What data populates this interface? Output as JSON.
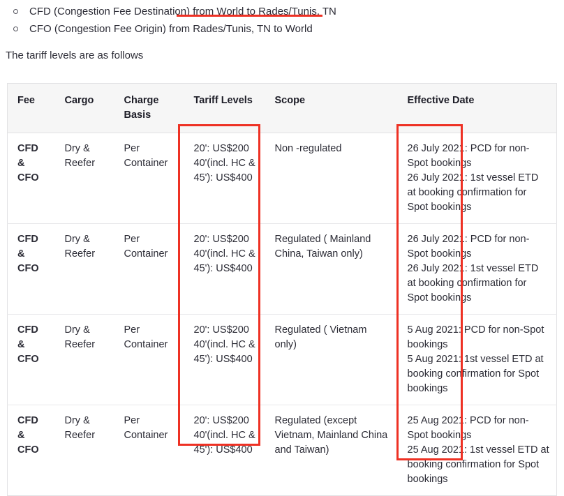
{
  "intro": {
    "bullets": [
      {
        "plain": "CFD (Congestion Fee Destination) ",
        "underlined": "from World to Rades/Tunis, TN"
      },
      {
        "plain": "CFO (Congestion Fee Origin) from Rades/Tunis, TN to World",
        "underlined": ""
      }
    ],
    "lead_paragraph": "The tariff levels are as follows"
  },
  "table": {
    "headers": [
      "Fee",
      "Cargo",
      "Charge Basis",
      "Tariff Levels",
      "Scope",
      "Effective Date"
    ],
    "rows": [
      {
        "fee": [
          "CFD",
          "&",
          "CFO"
        ],
        "cargo": [
          "Dry &",
          "Reefer"
        ],
        "charge_basis": [
          "Per Container"
        ],
        "tariff_levels": [
          "20': US$200",
          "40'(incl. HC & 45'): US$400"
        ],
        "scope": [
          "Non -regulated"
        ],
        "effective_date": [
          "26 July 2021: PCD for non-Spot bookings",
          "26 July 2021: 1st vessel ETD at booking confirmation for Spot bookings"
        ]
      },
      {
        "fee": [
          "CFD",
          "&",
          "CFO"
        ],
        "cargo": [
          "Dry &",
          "Reefer"
        ],
        "charge_basis": [
          "Per Container"
        ],
        "tariff_levels": [
          "20': US$200",
          "40'(incl. HC & 45'): US$400"
        ],
        "scope": [
          "Regulated ( Mainland China, Taiwan only)"
        ],
        "effective_date": [
          "26 July 2021: PCD for non-Spot bookings",
          "26 July 2021: 1st vessel ETD at booking confirmation for Spot bookings"
        ]
      },
      {
        "fee": [
          "CFD",
          "&",
          "CFO"
        ],
        "cargo": [
          "Dry &",
          "Reefer"
        ],
        "charge_basis": [
          "Per Container"
        ],
        "tariff_levels": [
          "20': US$200",
          "40'(incl. HC & 45'): US$400"
        ],
        "scope": [
          "Regulated ( Vietnam only)"
        ],
        "effective_date": [
          "5 Aug 2021: PCD for non-Spot bookings",
          "5 Aug 2021: 1st vessel ETD at booking confirmation for Spot bookings"
        ]
      },
      {
        "fee": [
          "CFD",
          "&",
          "CFO"
        ],
        "cargo": [
          "Dry &",
          "Reefer"
        ],
        "charge_basis": [
          "Per Container"
        ],
        "tariff_levels": [
          "20': US$200",
          "40'(incl. HC & 45'): US$400"
        ],
        "scope": [
          "Regulated (except Vietnam, Mainland China and Taiwan)"
        ],
        "effective_date": [
          "25 Aug 2021: PCD for non-Spot bookings",
          "25 Aug 2021: 1st vessel ETD at booking confirmation for Spot bookings"
        ]
      }
    ]
  },
  "annotations": {
    "highlight_color": "#ee3124",
    "boxes": [
      {
        "target": "tariff-levels-column"
      },
      {
        "target": "effective-date-column"
      }
    ],
    "underline": {
      "target": "cfd-scope-phrase"
    }
  }
}
